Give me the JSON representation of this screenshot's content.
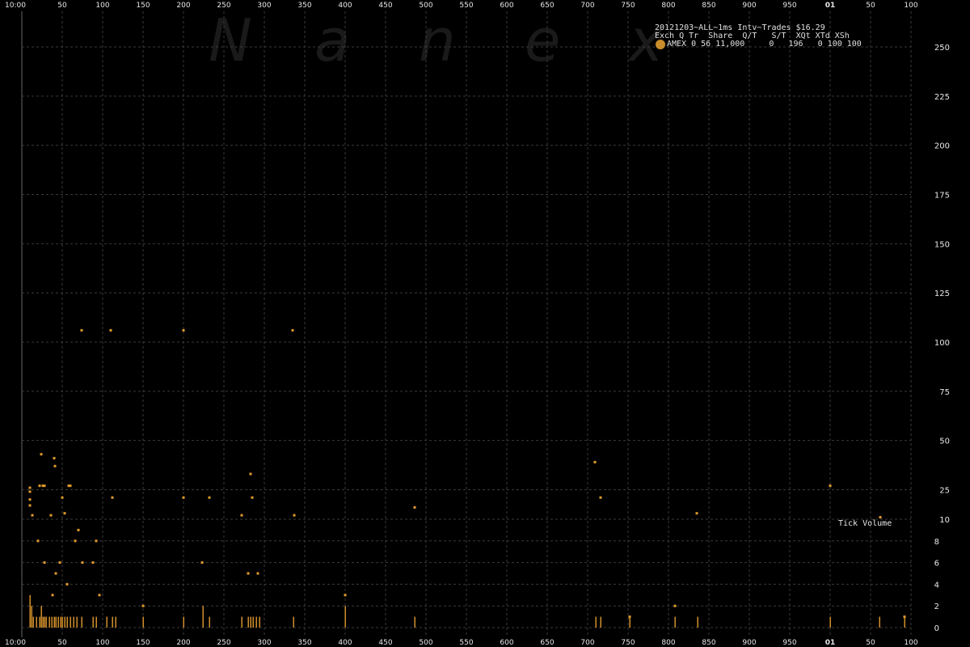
{
  "watermark": [
    "N",
    "a",
    "n",
    "e",
    "x"
  ],
  "legend": {
    "title": "20121203~ALL~1ms Intv~Trades $16.29",
    "header": "Exch Q Tr  Share  Q/T   S/T  XQt XTd XSh",
    "row": "AMEX 0 56 11,000     0   196   0 100 100",
    "dot_color": "#c98d2a"
  },
  "tick_volume_label": "Tick Volume",
  "colors": {
    "background": "#000000",
    "grid": "#3a3a3a",
    "axis_text": "#e8e8e8",
    "series": "#e09a2c"
  },
  "chart_data": {
    "type": "scatter",
    "x_axis": {
      "range": [
        0,
        1100
      ],
      "ticks": [
        0,
        50,
        100,
        150,
        200,
        250,
        300,
        350,
        400,
        450,
        500,
        550,
        600,
        650,
        700,
        750,
        800,
        850,
        900,
        950,
        1000,
        1050,
        1100
      ],
      "tick_labels": [
        "10:00",
        "50",
        "100",
        "150",
        "200",
        "250",
        "300",
        "350",
        "400",
        "450",
        "500",
        "550",
        "600",
        "650",
        "700",
        "750",
        "800",
        "850",
        "900",
        "950",
        "01",
        "50",
        "100"
      ],
      "bold_labels": [
        "01"
      ]
    },
    "y_axis_upper": {
      "scale": "linear",
      "range": [
        10,
        250
      ],
      "ticks": [
        10,
        25,
        50,
        75,
        100,
        125,
        150,
        175,
        200,
        225,
        250
      ]
    },
    "y_axis_lower": {
      "scale": "linear",
      "range": [
        0,
        10
      ],
      "ticks": [
        0,
        2,
        4,
        6,
        8,
        10
      ]
    },
    "grid": true,
    "series": [
      {
        "name": "Trades",
        "points": [
          [
            10,
            26
          ],
          [
            10,
            24
          ],
          [
            10,
            20
          ],
          [
            10,
            17
          ],
          [
            13,
            12
          ],
          [
            22,
            27
          ],
          [
            24,
            43
          ],
          [
            26,
            27
          ],
          [
            28,
            27
          ],
          [
            20,
            8
          ],
          [
            28,
            6
          ],
          [
            36,
            12
          ],
          [
            38,
            3
          ],
          [
            40,
            41
          ],
          [
            41,
            37
          ],
          [
            42,
            5
          ],
          [
            47,
            6
          ],
          [
            50,
            21
          ],
          [
            53,
            13
          ],
          [
            56,
            4
          ],
          [
            58,
            27
          ],
          [
            60,
            27
          ],
          [
            66,
            8
          ],
          [
            70,
            9
          ],
          [
            74,
            106
          ],
          [
            75,
            6
          ],
          [
            88,
            6
          ],
          [
            92,
            8
          ],
          [
            96,
            3
          ],
          [
            110,
            106
          ],
          [
            112,
            21
          ],
          [
            150,
            2
          ],
          [
            200,
            106
          ],
          [
            200,
            21
          ],
          [
            223,
            6
          ],
          [
            232,
            21
          ],
          [
            272,
            12
          ],
          [
            280,
            5
          ],
          [
            283,
            33
          ],
          [
            285,
            21
          ],
          [
            292,
            5
          ],
          [
            335,
            106
          ],
          [
            337,
            12
          ],
          [
            400,
            3
          ],
          [
            486,
            16
          ],
          [
            709,
            39
          ],
          [
            716,
            21
          ],
          [
            752,
            1
          ],
          [
            808,
            2
          ],
          [
            835,
            13
          ],
          [
            1000,
            27
          ],
          [
            1062,
            11
          ],
          [
            1092,
            1
          ]
        ]
      }
    ],
    "tick_volume": [
      [
        10,
        3
      ],
      [
        12,
        2
      ],
      [
        14,
        1
      ],
      [
        18,
        1
      ],
      [
        22,
        1
      ],
      [
        24,
        2
      ],
      [
        26,
        1
      ],
      [
        28,
        1
      ],
      [
        30,
        1
      ],
      [
        34,
        1
      ],
      [
        37,
        1
      ],
      [
        40,
        1
      ],
      [
        42,
        1
      ],
      [
        45,
        1
      ],
      [
        48,
        1
      ],
      [
        50,
        1
      ],
      [
        53,
        1
      ],
      [
        56,
        1
      ],
      [
        60,
        1
      ],
      [
        64,
        1
      ],
      [
        68,
        1
      ],
      [
        74,
        1
      ],
      [
        88,
        1
      ],
      [
        92,
        1
      ],
      [
        105,
        1
      ],
      [
        112,
        1
      ],
      [
        116,
        1
      ],
      [
        150,
        1
      ],
      [
        200,
        1
      ],
      [
        224,
        2
      ],
      [
        232,
        1
      ],
      [
        272,
        1
      ],
      [
        280,
        1
      ],
      [
        283,
        1
      ],
      [
        286,
        1
      ],
      [
        290,
        1
      ],
      [
        294,
        1
      ],
      [
        336,
        1
      ],
      [
        400,
        2
      ],
      [
        486,
        1
      ],
      [
        710,
        1
      ],
      [
        716,
        1
      ],
      [
        752,
        1
      ],
      [
        808,
        1
      ],
      [
        836,
        1
      ],
      [
        1000,
        1
      ],
      [
        1061,
        1
      ],
      [
        1092,
        1
      ]
    ]
  }
}
